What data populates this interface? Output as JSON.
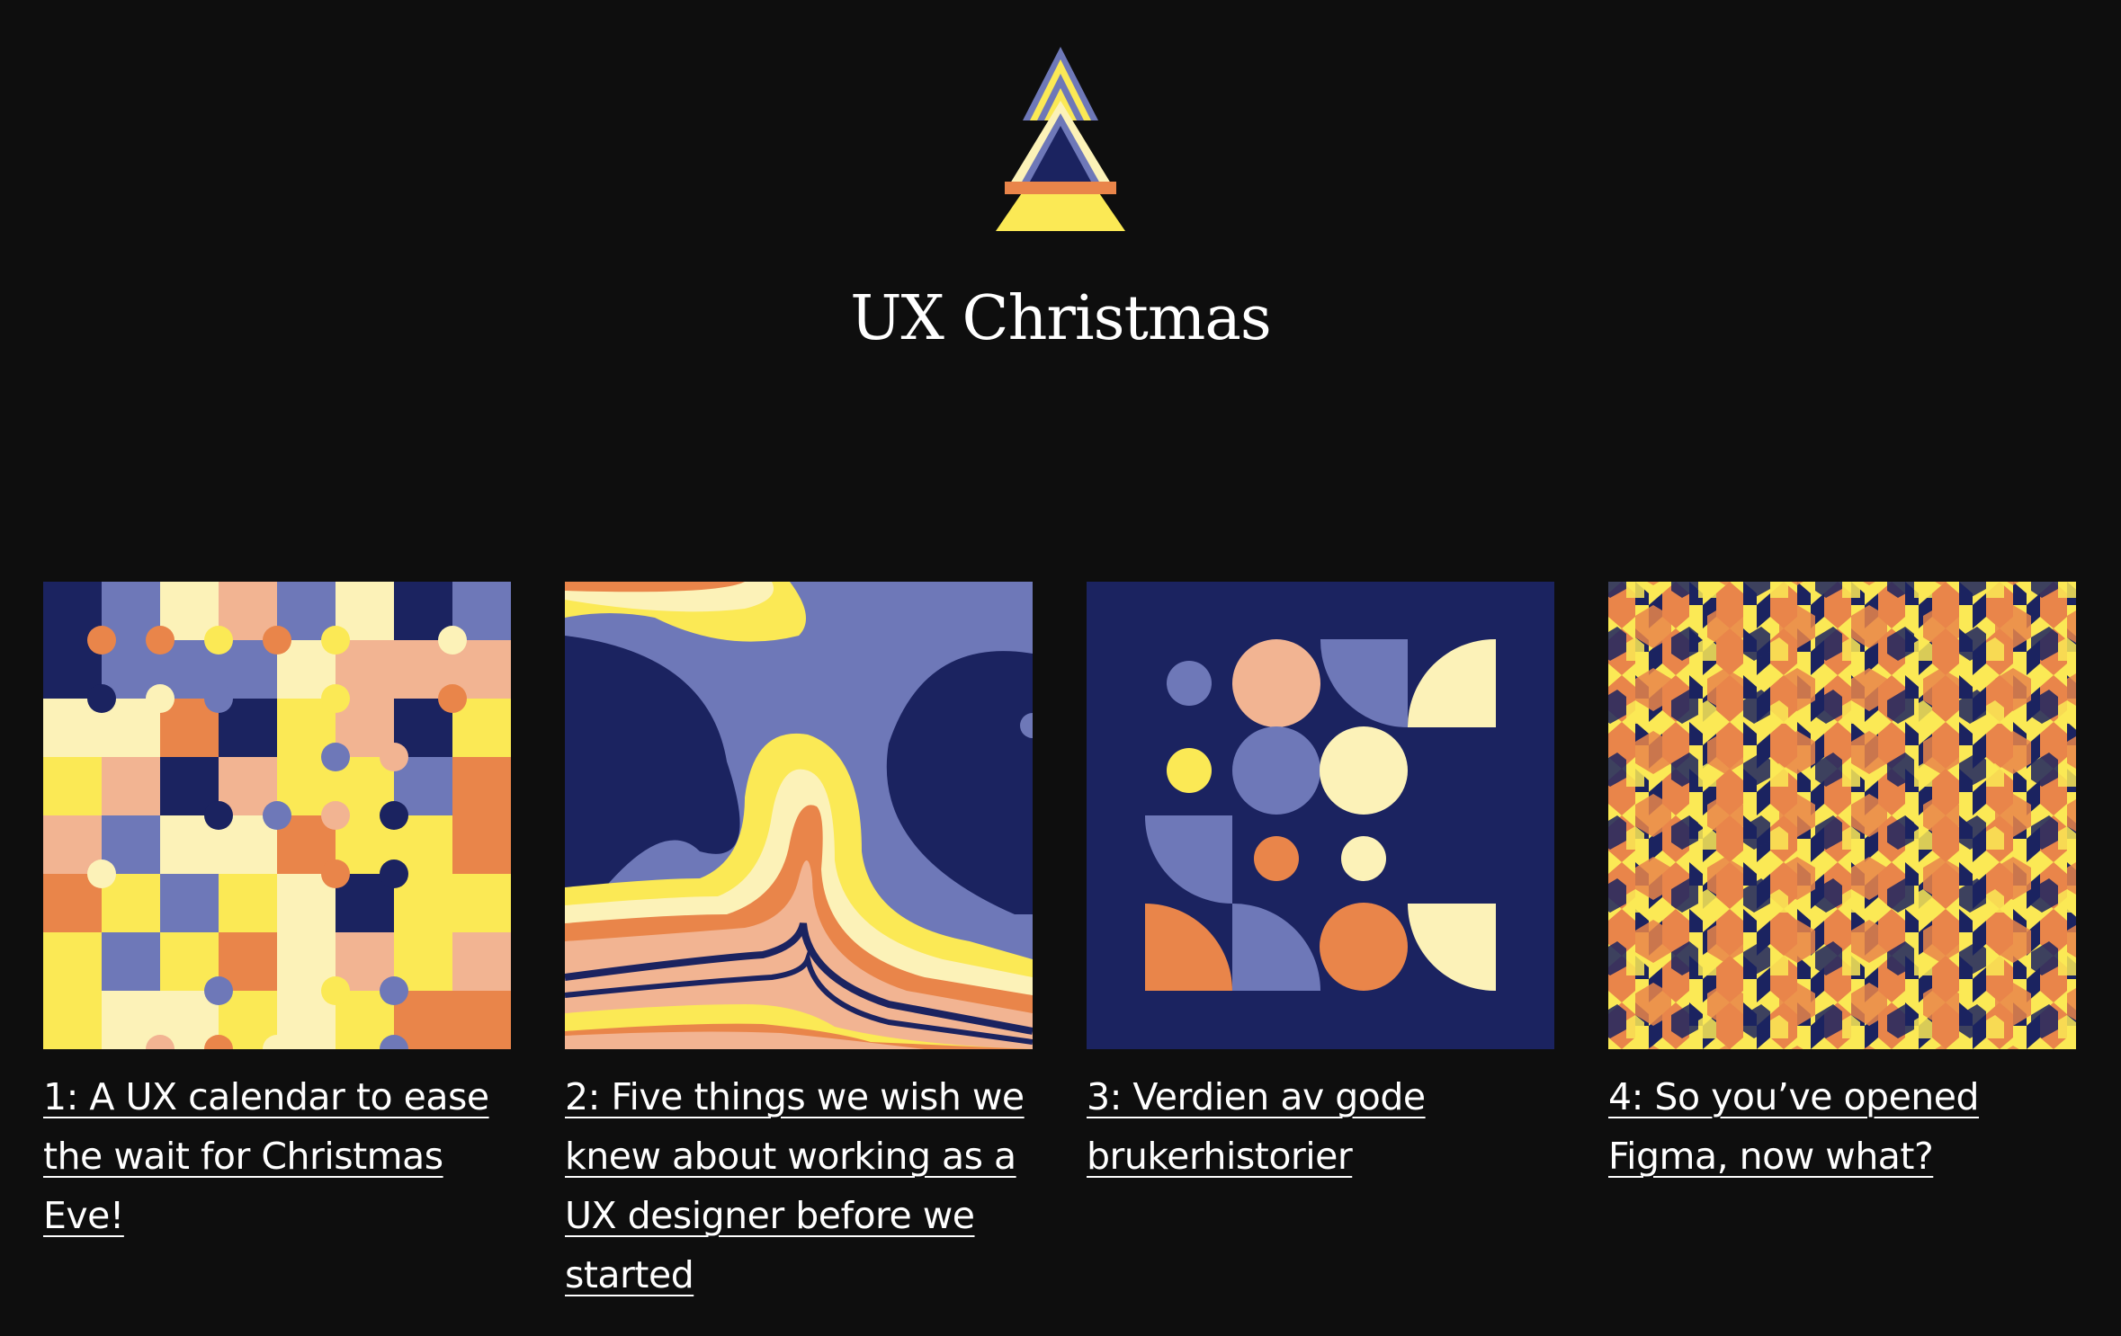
{
  "site": {
    "title": "UX Christmas",
    "logo_icon": "christmas-tree-logo-icon"
  },
  "colors": {
    "background": "#0e0e0e",
    "navy": "#1b2360",
    "periwinkle": "#6e78b8",
    "yellow": "#fbe955",
    "cream": "#fcf2b8",
    "peach": "#f2b492",
    "orange": "#e9854a",
    "text": "#ffffff"
  },
  "articles": [
    {
      "number": "1",
      "title": "1: A UX calendar to ease the wait for Christmas Eve!",
      "thumbnail": "grid-circles-pattern"
    },
    {
      "number": "2",
      "title": "2: Five things we wish we knew about working as a UX designer before we started",
      "thumbnail": "wavy-stripes-pattern"
    },
    {
      "number": "3",
      "title": "3: Verdien av gode brukerhistorier",
      "thumbnail": "circles-and-quarters-pattern"
    },
    {
      "number": "4",
      "title": "4: So you’ve opened Figma, now what?",
      "thumbnail": "hexagon-mosaic-pattern"
    }
  ]
}
